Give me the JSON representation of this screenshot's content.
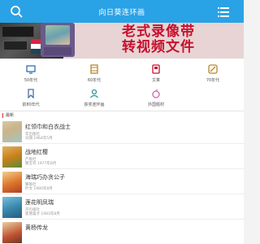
{
  "header": {
    "title": "向日葵连环画",
    "search_icon": "search-icon",
    "menu_icon": "menu-icon",
    "bg_color": "#2aa2e6"
  },
  "banner": {
    "headline_line1": "老式录像带",
    "headline_line2": "转视频文件"
  },
  "categories": [
    {
      "label": "50年代",
      "icon": "tv-icon",
      "color": "#2d6fb8"
    },
    {
      "label": "60年代",
      "icon": "film-icon",
      "color": "#b8862d"
    },
    {
      "label": "文革",
      "icon": "book-icon",
      "color": "#c8102e"
    },
    {
      "label": "70年代",
      "icon": "tape-icon",
      "color": "#b8862d"
    },
    {
      "label": "前80年代",
      "icon": "bookmark-icon",
      "color": "#4a6ea8"
    },
    {
      "label": "获奖连环画",
      "icon": "user-icon",
      "color": "#2a9a9a"
    },
    {
      "label": "外国题材",
      "icon": "apple-icon",
      "color": "#c96aa8"
    }
  ],
  "section": {
    "title": "最新"
  },
  "items": [
    {
      "title": "红领巾和白衣战士",
      "meta1": "年出版社",
      "meta2": "日期 1964年5月"
    },
    {
      "title": "战地红樱",
      "meta1": "严版社",
      "meta2": "繁宝刊 1977年8月"
    },
    {
      "title": "海瑞巧办贪公子",
      "meta1": "繁版社",
      "meta2": "叶文 1980年8月"
    },
    {
      "title": "莲花明凤瑞",
      "meta1": "开包版社",
      "meta2": "崔德喜才 1983年8月"
    },
    {
      "title": "黄杨传龙",
      "meta1": "",
      "meta2": ""
    }
  ]
}
